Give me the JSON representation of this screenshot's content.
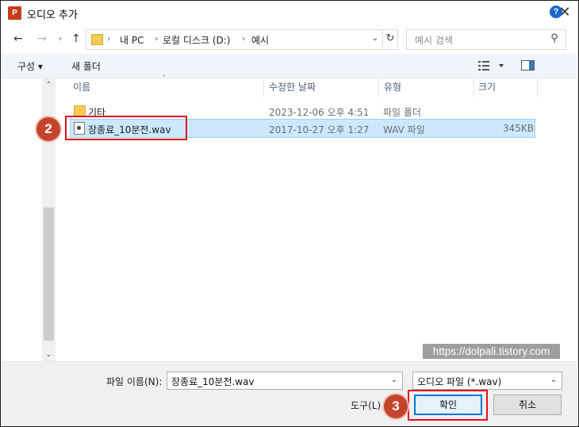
{
  "window": {
    "title": "오디오 추가",
    "app_icon_text": "P"
  },
  "nav": {
    "back_icon": "arrow-left-icon",
    "forward_icon": "arrow-right-icon",
    "recent_icon": "chevron-down-icon",
    "up_icon": "arrow-up-icon",
    "breadcrumbs": [
      "내 PC",
      "로컬 디스크 (D:)",
      "예시"
    ],
    "search_placeholder": "예시 검색"
  },
  "toolbar": {
    "organize": "구성 ▾",
    "new_folder": "새 폴더"
  },
  "columns": {
    "name": "이름",
    "date": "수정한 날짜",
    "type": "유형",
    "size": "크기"
  },
  "files": [
    {
      "name": "기타",
      "date": "2023-12-06 오후 4:51",
      "type": "파일 폴더",
      "size": "",
      "icon": "folder-icon",
      "selected": false
    },
    {
      "name": "장종료_10분전.wav",
      "date": "2017-10-27 오후 1:27",
      "type": "WAV 파일",
      "size": "345KB",
      "icon": "audio-file-icon",
      "selected": true
    }
  ],
  "annotations": {
    "step2": "2",
    "step3": "3"
  },
  "watermark": "https://dolpali.tistory.com",
  "bottom": {
    "filename_label": "파일 이름(N):",
    "filename_value": "장종료_10분전.wav",
    "filter_value": "오디오 파일 (*.wav)",
    "tools_label": "도구(L) ▾",
    "ok": "확인",
    "cancel": "취소"
  },
  "colors": {
    "selection": "#cce8ff",
    "highlight": "#e3101c",
    "badge": "#c4452d",
    "accent": "#0078d7"
  }
}
